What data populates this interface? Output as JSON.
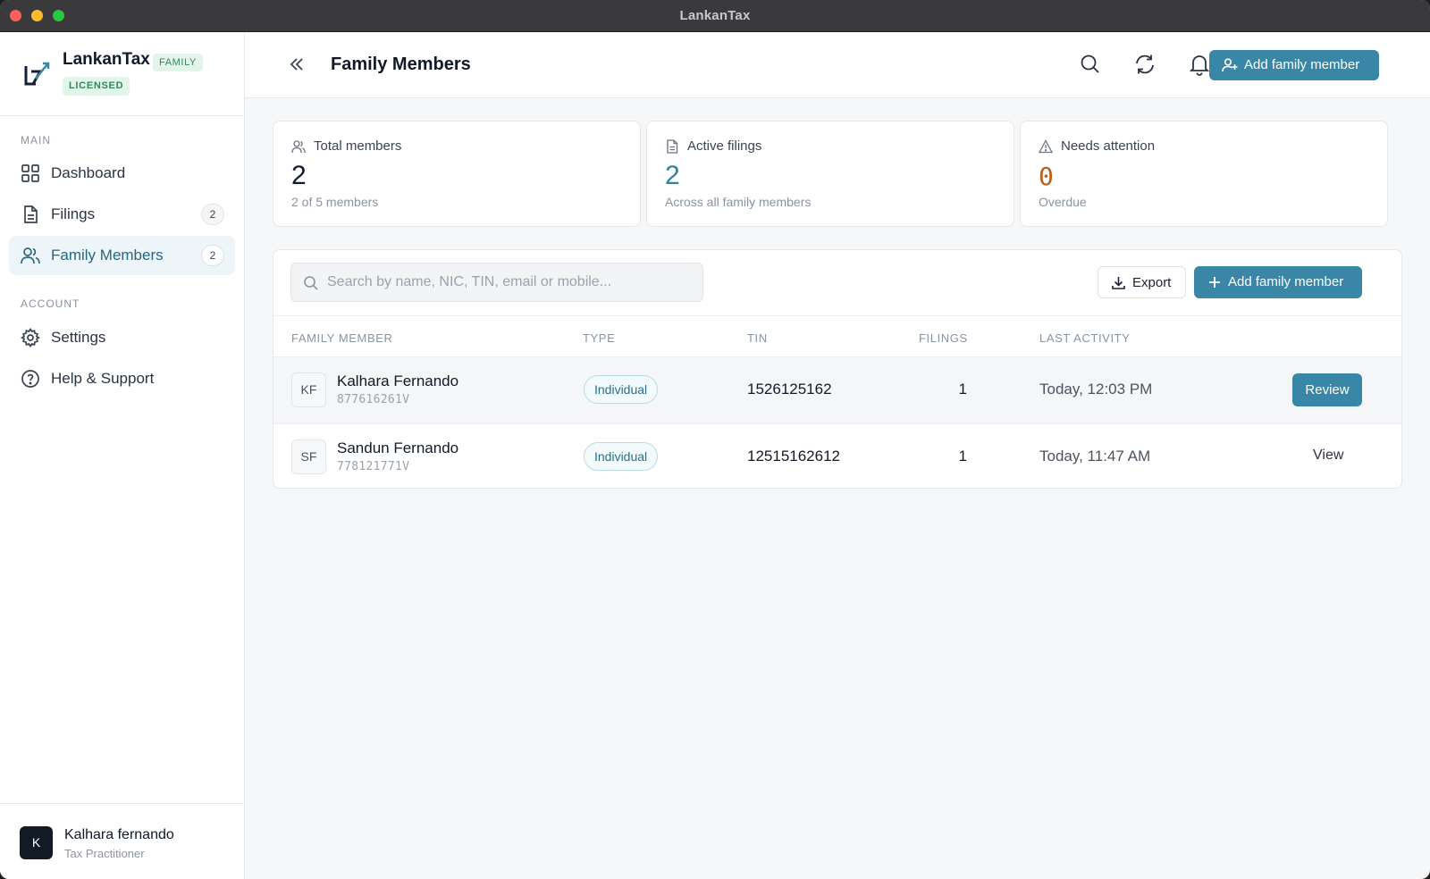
{
  "window": {
    "title": "LankanTax"
  },
  "brand": {
    "name": "LankanTax",
    "tier_badge": "FAMILY",
    "license_badge": "LICENSED"
  },
  "sidebar": {
    "main_section": "MAIN",
    "account_section": "ACCOUNT",
    "items": [
      {
        "label": "Dashboard",
        "icon": "grid-icon"
      },
      {
        "label": "Filings",
        "icon": "document-icon",
        "count": "2"
      },
      {
        "label": "Family Members",
        "icon": "users-icon",
        "count": "2",
        "active": true
      },
      {
        "label": "Settings",
        "icon": "gear-icon"
      },
      {
        "label": "Help & Support",
        "icon": "help-circle-icon"
      }
    ]
  },
  "user": {
    "initial": "K",
    "name": "Kalhara fernando",
    "role": "Tax Practitioner"
  },
  "header": {
    "title": "Family Members",
    "add_button": "Add family member"
  },
  "stats": [
    {
      "label": "Total members",
      "value": "2",
      "sub": "2 of 5 members",
      "icon": "users-icon"
    },
    {
      "label": "Active filings",
      "value": "2",
      "sub": "Across all family members",
      "icon": "document-icon"
    },
    {
      "label": "Needs attention",
      "value": "0",
      "sub": "Overdue",
      "icon": "warning-icon"
    }
  ],
  "toolbar": {
    "search_placeholder": "Search by name, NIC, TIN, email or mobile...",
    "export_label": "Export",
    "add_label": "Add family member"
  },
  "table": {
    "columns": [
      "FAMILY MEMBER",
      "TYPE",
      "TIN",
      "FILINGS",
      "LAST ACTIVITY"
    ],
    "rows": [
      {
        "initials": "KF",
        "name": "Kalhara Fernando",
        "nic": "877616261V",
        "type": "Individual",
        "tin": "1526125162",
        "filings": "1",
        "last_activity": "Today, 12:03 PM",
        "action": "Review"
      },
      {
        "initials": "SF",
        "name": "Sandun Fernando",
        "nic": "778121771V",
        "type": "Individual",
        "tin": "12515162612",
        "filings": "1",
        "last_activity": "Today, 11:47 AM",
        "action": "View"
      }
    ]
  },
  "colors": {
    "accent": "#3a86a6",
    "accent_text": "#27667e",
    "warning": "#b5601d",
    "success_badge": "#2f8a55"
  }
}
